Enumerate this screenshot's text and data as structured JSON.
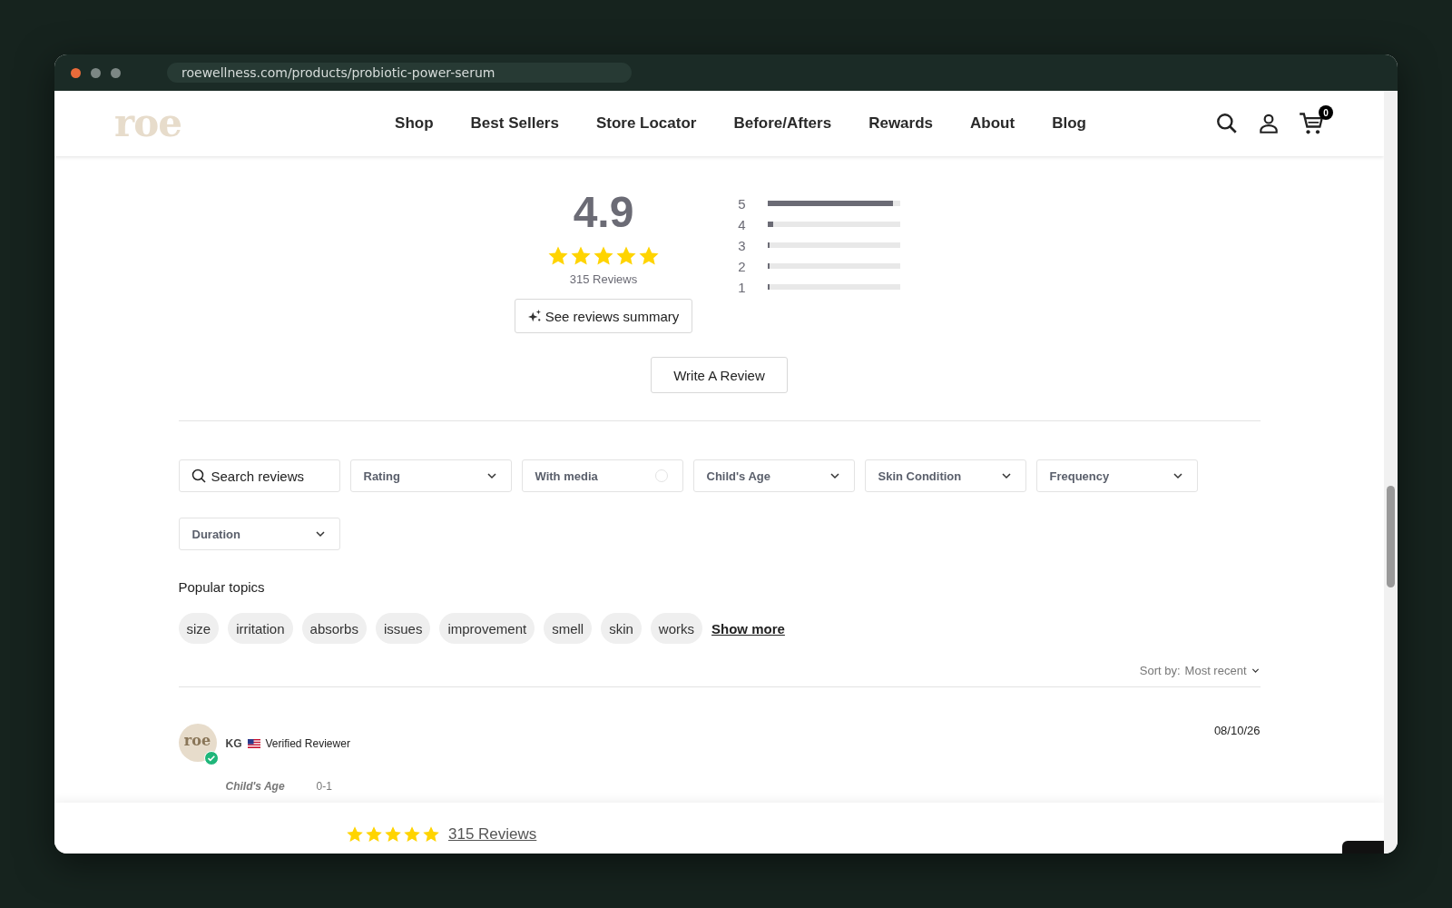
{
  "browser": {
    "url": "roewellness.com/products/probiotic-power-serum"
  },
  "header": {
    "logo": "roe",
    "nav": [
      "Shop",
      "Best Sellers",
      "Store Locator",
      "Before/Afters",
      "Rewards",
      "About",
      "Blog"
    ],
    "cart_count": "0"
  },
  "summary": {
    "average": "4.9",
    "stars": 5,
    "count_label": "315 Reviews",
    "summary_button": "See reviews summary",
    "distribution": [
      {
        "label": "5",
        "level": 0.94
      },
      {
        "label": "4",
        "level": 0.04
      },
      {
        "label": "3",
        "level": 0
      },
      {
        "label": "2",
        "level": 0.015
      },
      {
        "label": "1",
        "level": 0.006
      }
    ]
  },
  "write_review": "Write A Review",
  "filters": [
    {
      "kind": "search",
      "placeholder": "Search reviews"
    },
    {
      "kind": "dropdown",
      "label": "Rating"
    },
    {
      "kind": "toggle",
      "label": "With media",
      "checked": false
    },
    {
      "kind": "dropdown",
      "label": "Child's Age"
    },
    {
      "kind": "dropdown",
      "label": "Skin Condition"
    },
    {
      "kind": "dropdown",
      "label": "Frequency"
    },
    {
      "kind": "dropdown",
      "label": "Duration"
    }
  ],
  "topics": {
    "title": "Popular topics",
    "chips": [
      "size",
      "irritation",
      "absorbs",
      "issues",
      "improvement",
      "smell",
      "skin",
      "works"
    ],
    "show_more": "Show more"
  },
  "sort": {
    "label": "Sort by:",
    "value": "Most recent"
  },
  "reviews": [
    {
      "avatar_text": "roe",
      "verified": true,
      "name": "KG",
      "badge": "Verified Reviewer",
      "date": "08/10/26",
      "answers": [
        {
          "question": "Child's Age",
          "answer": "0-1"
        }
      ]
    }
  ],
  "sticky_bar": {
    "stars": 5,
    "link": "315 Reviews"
  }
}
